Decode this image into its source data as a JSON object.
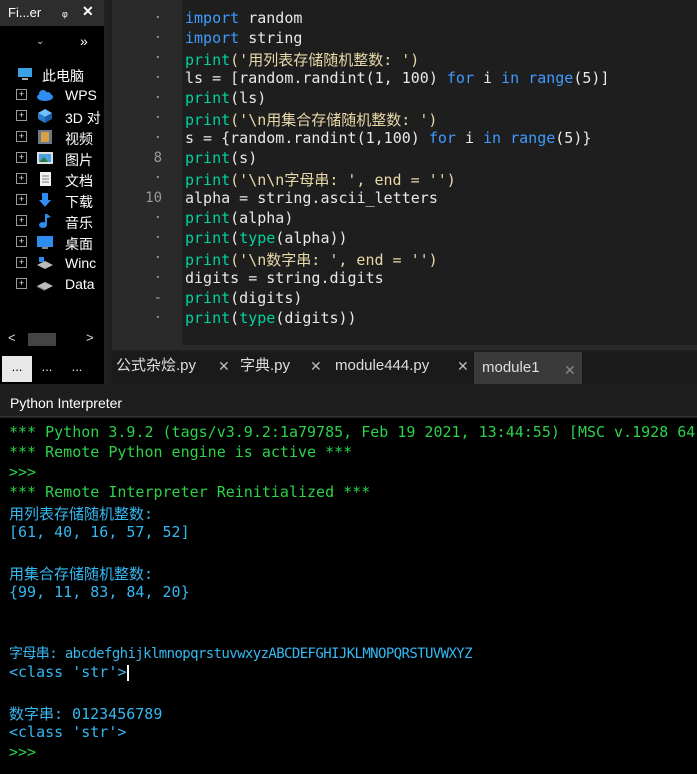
{
  "explorer": {
    "title": "Fi...er",
    "pin_icon": "pin-icon",
    "close_label": "✕",
    "dropdown_icon": "chevron-down-icon",
    "more_label": "»",
    "root": {
      "label": "此电脑",
      "icon": "computer-icon"
    },
    "items": [
      {
        "label": "WPS",
        "icon": "cloud-icon",
        "expand": "+"
      },
      {
        "label": "3D 对",
        "icon": "3d-objects-icon",
        "expand": "+"
      },
      {
        "label": "视频",
        "icon": "video-icon",
        "expand": "+"
      },
      {
        "label": "图片",
        "icon": "picture-icon",
        "expand": "+"
      },
      {
        "label": "文档",
        "icon": "document-icon",
        "expand": "+"
      },
      {
        "label": "下载",
        "icon": "download-icon",
        "expand": "+"
      },
      {
        "label": "音乐",
        "icon": "music-icon",
        "expand": "+"
      },
      {
        "label": "桌面",
        "icon": "desktop-icon",
        "expand": "+"
      },
      {
        "label": "Winc",
        "icon": "drive-icon",
        "expand": "+"
      },
      {
        "label": "Data",
        "icon": "drive-icon",
        "expand": "+"
      }
    ],
    "scroll_left": "<",
    "scroll_right": ">",
    "tabs": [
      "...",
      "...",
      "..."
    ]
  },
  "editor": {
    "gutter": [
      "·",
      "·",
      "·",
      "·",
      "·",
      "·",
      "·",
      "8",
      "·",
      "10",
      "·",
      "·",
      "·",
      "·",
      "-",
      "·"
    ],
    "tabs": [
      {
        "label": "公式杂烩.py",
        "close": "✕"
      },
      {
        "label": "字典.py",
        "close": "✕"
      },
      {
        "label": "module444.py",
        "close": "✕"
      },
      {
        "label": "module1",
        "close": "✕"
      }
    ],
    "active_tab": "module1"
  },
  "interpreter": {
    "title": "Python Interpreter",
    "lines": [
      "*** Python 3.9.2 (tags/v3.9.2:1a79785, Feb 19 2021, 13:44:55) [MSC v.1928 64",
      "*** Remote Python engine is active ***",
      ">>>",
      "*** Remote Interpreter Reinitialized ***",
      "用列表存储随机整数:",
      "[61, 40, 16, 57, 52]",
      "",
      "用集合存储随机整数:",
      "{99, 11, 83, 84, 20}",
      "",
      "",
      "字母串: abcdefghijklmnopqrstuvwxyzABCDEFGHIJKLMNOPQRSTUVWXYZ",
      "<class 'str'>",
      "",
      "数字串: 0123456789",
      "<class 'str'>",
      ">>>"
    ]
  }
}
